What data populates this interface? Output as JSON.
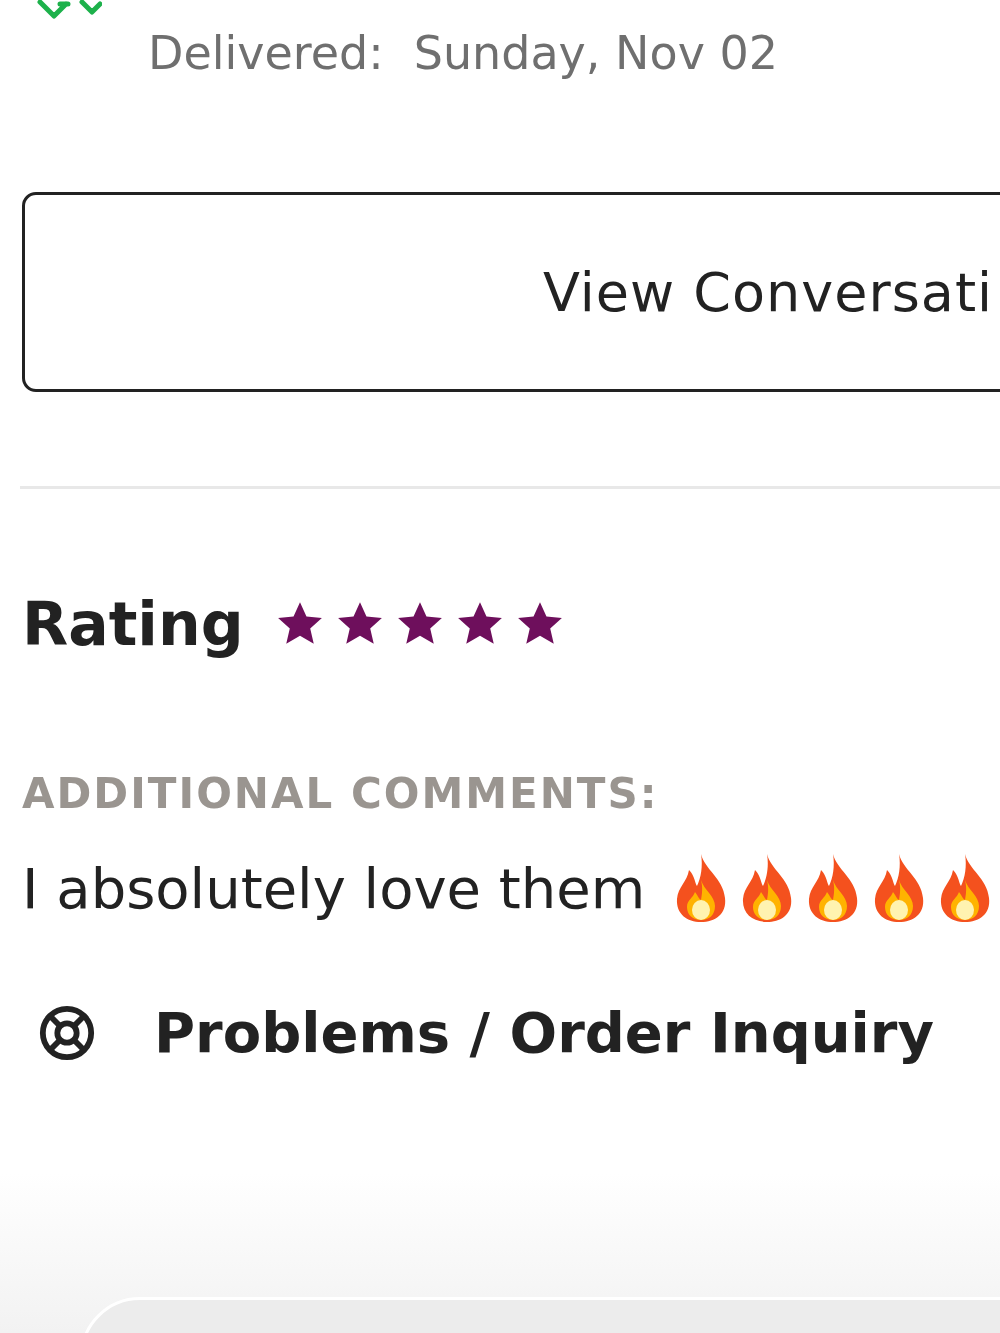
{
  "delivery": {
    "label": "Delivered:",
    "date": "Sunday, Nov 02"
  },
  "conversation_button": {
    "label": "View Conversati"
  },
  "rating": {
    "label": "Rating",
    "stars": 5
  },
  "comments": {
    "heading": "ADDITIONAL COMMENTS:",
    "text": "I absolutely love them"
  },
  "help_link": {
    "label": "Problems / Order Inquiry"
  }
}
